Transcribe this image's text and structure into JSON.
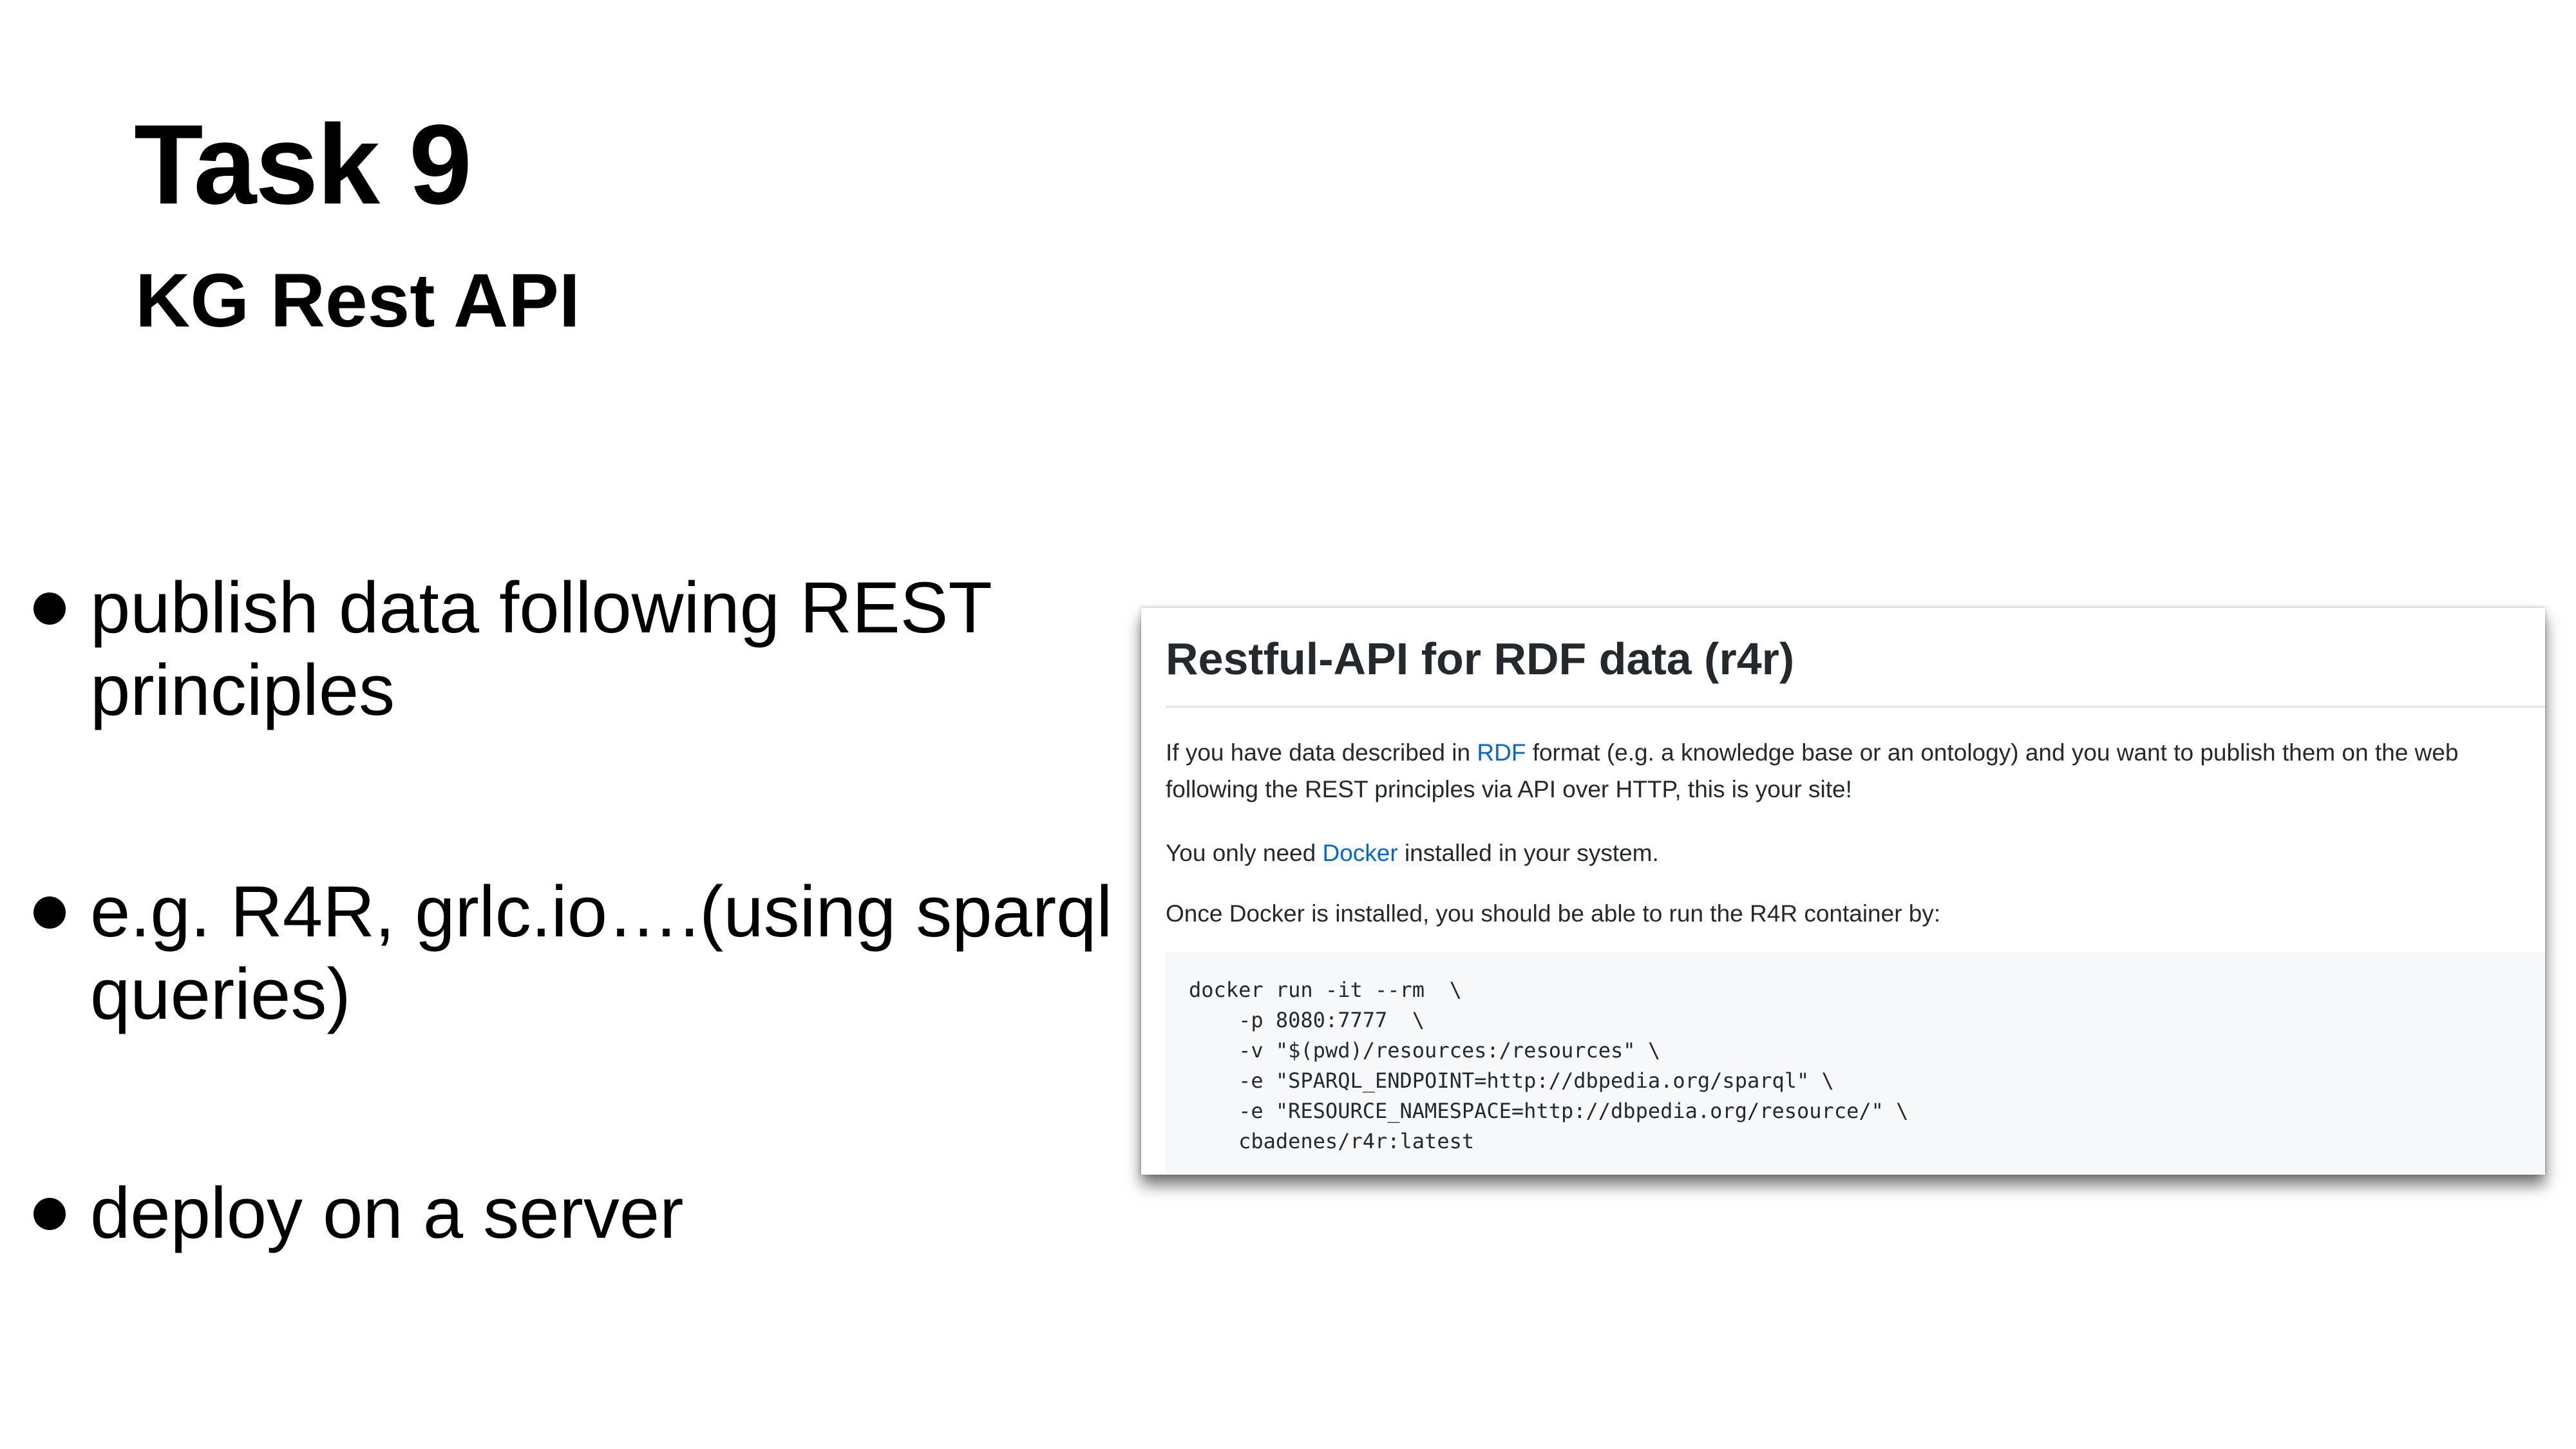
{
  "slide": {
    "title": "Task 9",
    "subtitle": "KG Rest API",
    "bullets": [
      {
        "lines": [
          "publish data following REST",
          "principles"
        ]
      },
      {
        "lines": [
          "e.g. R4R, grlc.io….(using sparql",
          "queries)"
        ]
      },
      {
        "lines": [
          "deploy on a server"
        ]
      }
    ]
  },
  "screenshot": {
    "heading": "Restful-API for RDF data (r4r)",
    "para1": {
      "before": "If you have data described in ",
      "link": "RDF",
      "after_line1": " format (e.g. a knowledge base or an ontology) and you want to publish them on the web",
      "line2": "following the REST principles via API over HTTP, this is your site!"
    },
    "para2": {
      "before": "You only need ",
      "link": "Docker",
      "after": " installed in your system."
    },
    "para3": "Once Docker is installed, you should be able to run the R4R container by:",
    "code_lines": [
      "docker run -it --rm  \\",
      "    -p 8080:7777  \\",
      "    -v \"$(pwd)/resources:/resources\" \\",
      "    -e \"SPARQL_ENDPOINT=http://dbpedia.org/sparql\" \\",
      "    -e \"RESOURCE_NAMESPACE=http://dbpedia.org/resource/\" \\",
      "    cbadenes/r4r:latest"
    ]
  },
  "colors": {
    "link": "#0366d6",
    "heading_text": "#24292e",
    "code_background": "#f6f8fa"
  }
}
